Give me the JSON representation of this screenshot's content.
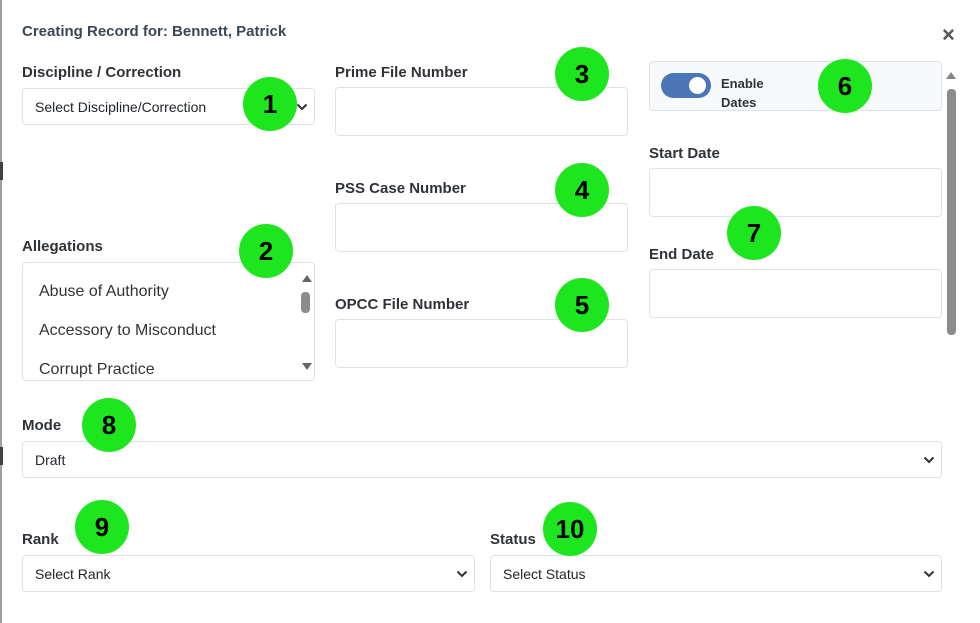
{
  "modal": {
    "title": "Creating Record for: Bennett, Patrick",
    "close_glyph": "×"
  },
  "form": {
    "discipline": {
      "label": "Discipline / Correction",
      "value": "Select Discipline/Correction"
    },
    "allegations": {
      "label": "Allegations",
      "items": [
        "Abuse of Authority",
        "Accessory to Misconduct",
        "Corrupt Practice"
      ]
    },
    "prime_file": {
      "label": "Prime File Number",
      "value": ""
    },
    "pss_case": {
      "label": "PSS Case Number",
      "value": ""
    },
    "opcc_file": {
      "label": "OPCC File Number",
      "value": ""
    },
    "enable_dates": {
      "label": "Enable Dates",
      "checked": true
    },
    "start_date": {
      "label": "Start Date",
      "value": ""
    },
    "end_date": {
      "label": "End Date",
      "value": ""
    },
    "mode": {
      "label": "Mode",
      "value": "Draft"
    },
    "rank": {
      "label": "Rank",
      "value": "Select Rank"
    },
    "status": {
      "label": "Status",
      "value": "Select Status"
    }
  },
  "annotations": [
    "1",
    "2",
    "3",
    "4",
    "5",
    "6",
    "7",
    "8",
    "9",
    "10"
  ],
  "icons": {
    "select_caret": "chevron-down-icon",
    "close": "close-icon",
    "scroll_up": "triangle-up-icon",
    "scroll_down": "triangle-down-icon"
  },
  "colors": {
    "badge": "#1ee61e",
    "toggle_on": "#4a76b8",
    "border": "#dee2e6",
    "title": "#3d4751"
  }
}
